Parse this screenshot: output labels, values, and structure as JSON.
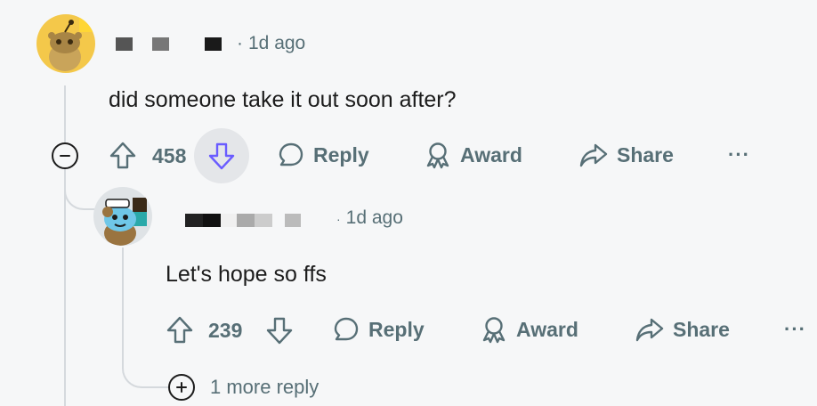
{
  "comment": {
    "time": "1d ago",
    "body": "did someone take it out soon after?",
    "upvotes": "458",
    "reply_label": "Reply",
    "award_label": "Award",
    "share_label": "Share",
    "more_label": "···"
  },
  "reply": {
    "time": "1d ago",
    "body": "Let's hope so ffs",
    "upvotes": "239",
    "reply_label": "Reply",
    "award_label": "Award",
    "share_label": "Share",
    "more_label": "···",
    "more_replies": "1 more reply"
  },
  "icons": {
    "upvote": "arrow-up-icon",
    "downvote": "arrow-down-icon",
    "reply": "speech-bubble-icon",
    "award": "ribbon-icon",
    "share": "forward-arrow-icon",
    "collapse": "minus-circle-icon",
    "expand": "plus-circle-icon"
  },
  "colors": {
    "background": "#f6f7f8",
    "muted_text": "#576f76",
    "downvote_active": "#6a5cff",
    "thread_line": "#d5d9dd"
  }
}
